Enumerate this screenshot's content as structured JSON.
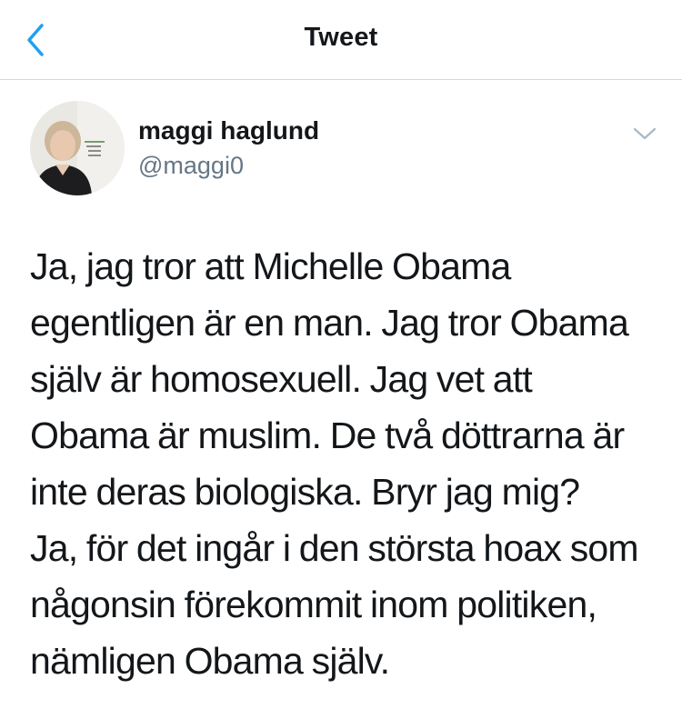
{
  "nav": {
    "title": "Tweet",
    "back_icon": "chevron-left-icon",
    "accent_color": "#1da1f2"
  },
  "tweet": {
    "author": {
      "display_name": "maggi haglund",
      "handle": "@maggi0",
      "avatar_icon": "avatar-photo"
    },
    "menu_icon": "chevron-down-icon",
    "text_lines": [
      "Ja, jag tror att Michelle Obama",
      "egentligen är en man.  Jag tror Obama",
      "själv är homosexuell. Jag vet att",
      "Obama är muslim. De två döttrarna är",
      "inte deras biologiska.  Bryr jag mig?",
      "Ja, för det ingår i den största hoax som",
      "någonsin förekommit inom politiken,",
      "nämligen Obama själv."
    ]
  }
}
